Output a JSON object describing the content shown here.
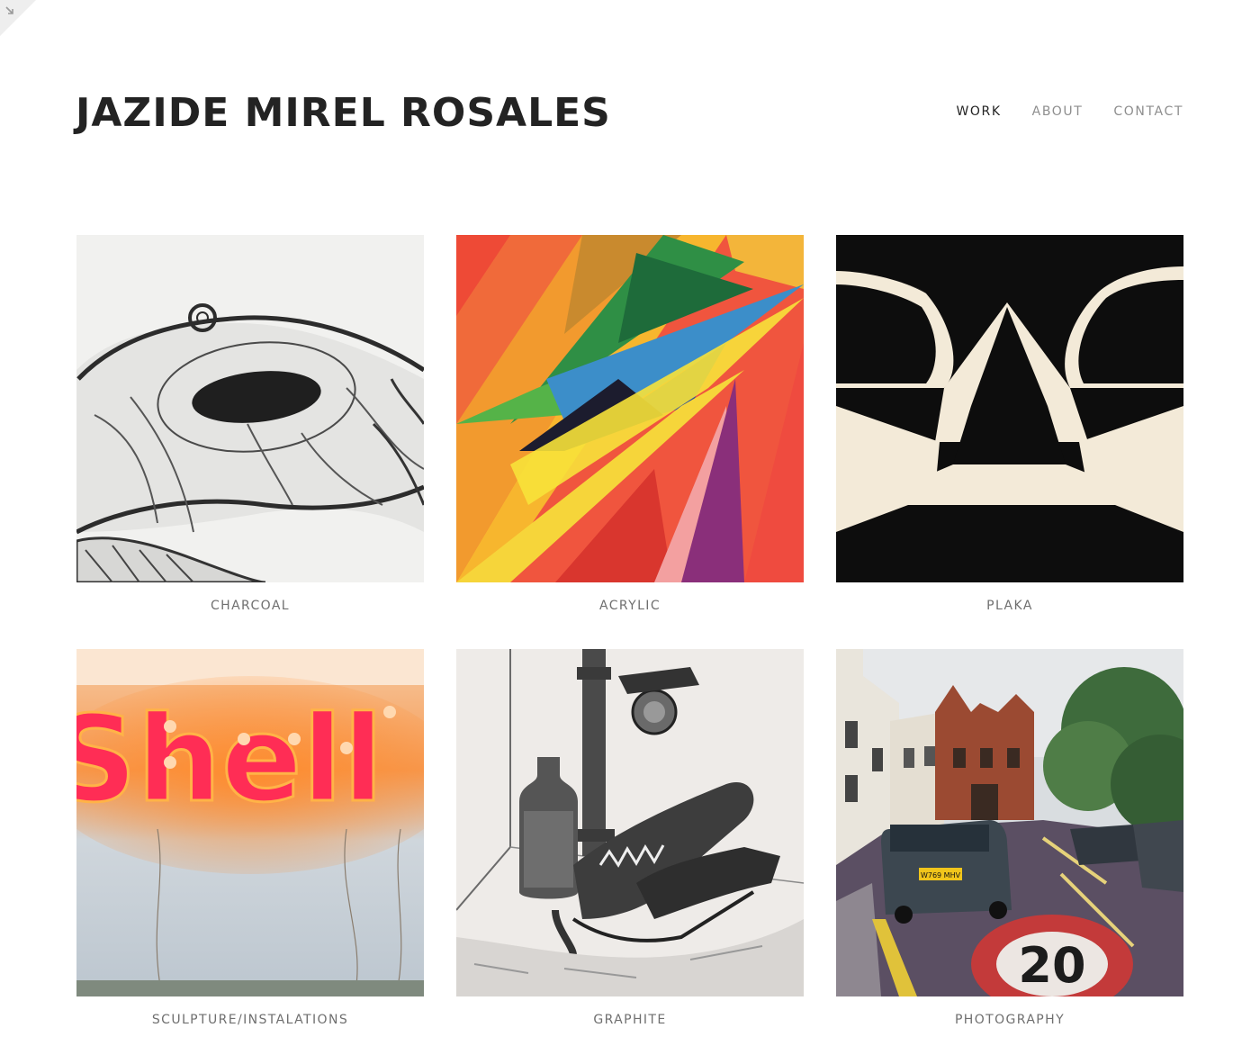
{
  "site": {
    "title": "JAZIDE MIREL ROSALES"
  },
  "nav": {
    "items": [
      {
        "label": "WORK",
        "active": true
      },
      {
        "label": "ABOUT",
        "active": false
      },
      {
        "label": "CONTACT",
        "active": false
      }
    ]
  },
  "gallery": {
    "items": [
      {
        "label": "CHARCOAL",
        "icon": "charcoal-artwork-image"
      },
      {
        "label": "ACRYLIC",
        "icon": "acrylic-artwork-image"
      },
      {
        "label": "PLAKA",
        "icon": "plaka-artwork-image"
      },
      {
        "label": "SCULPTURE/INSTALATIONS",
        "icon": "sculpture-artwork-image"
      },
      {
        "label": "GRAPHITE",
        "icon": "graphite-artwork-image"
      },
      {
        "label": "PHOTOGRAPHY",
        "icon": "photography-artwork-image"
      }
    ]
  },
  "photo": {
    "sign_text": "Shell",
    "plate_text": "W769 MHV",
    "road_marking": "20"
  },
  "colors": {
    "title": "#232323",
    "nav_active": "#232323",
    "nav_inactive": "#8e8e8e",
    "caption": "#6f6f6f",
    "background": "#ffffff"
  }
}
